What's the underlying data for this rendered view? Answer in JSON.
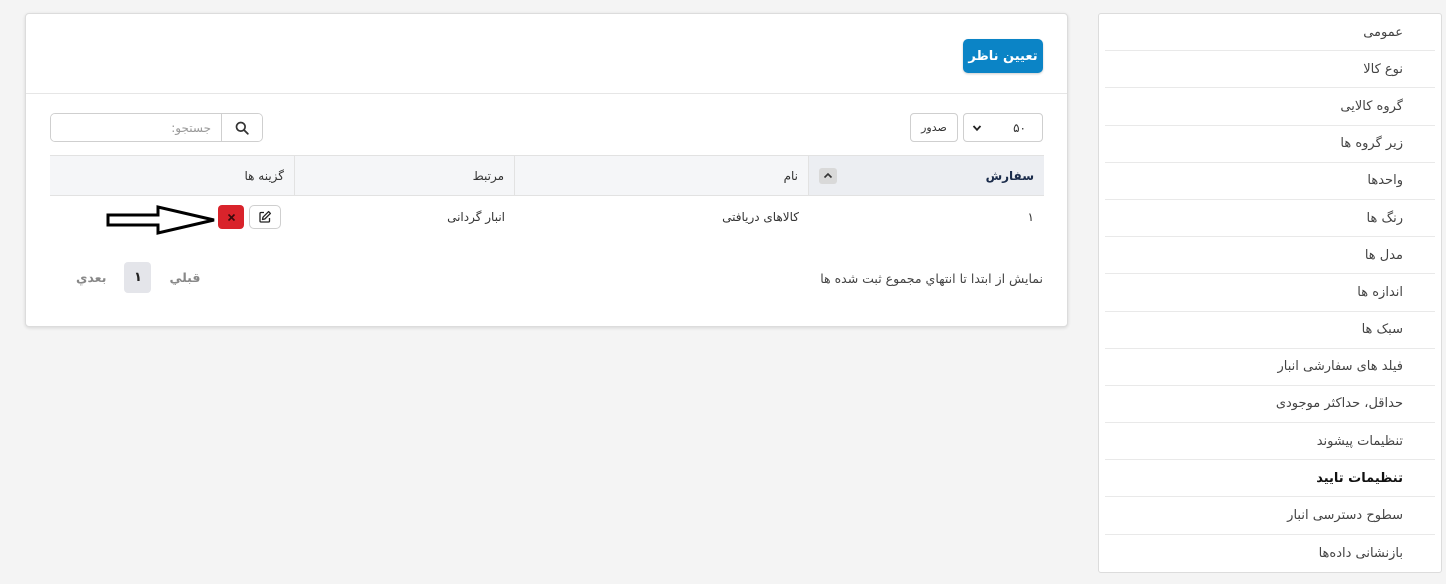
{
  "sidebar": {
    "items": [
      {
        "label": "عمومی"
      },
      {
        "label": "نوع کالا"
      },
      {
        "label": "گروه کالایی"
      },
      {
        "label": "زیر گروه ها"
      },
      {
        "label": "واحدها"
      },
      {
        "label": "رنگ ها"
      },
      {
        "label": "مدل ها"
      },
      {
        "label": "اندازه ها"
      },
      {
        "label": "سبک ها"
      },
      {
        "label": "فیلد های سفارشی انبار"
      },
      {
        "label": "حداقل، حداکثر موجودی"
      },
      {
        "label": "تنظیمات پیشوند"
      },
      {
        "label": "تنظیمات تایید"
      },
      {
        "label": "سطوح دسترسی انبار"
      },
      {
        "label": "بازنشانی داده‌ها"
      }
    ],
    "active_index": 12
  },
  "card": {
    "assign_button": "تعیین ناظر"
  },
  "controls": {
    "page_size": "۵۰",
    "export_label": "صدور",
    "search_placeholder": "جستجو:"
  },
  "table": {
    "headers": {
      "order": "سفارش",
      "name": "نام",
      "related": "مرتبط",
      "options": "گزینه ها"
    },
    "rows": [
      {
        "order": "۱",
        "name": "کالاهای دریافتی",
        "related": "انبار گردانی"
      }
    ]
  },
  "footer": {
    "info": "نمایش از ابتدا تا انتهاي مجموع ثبت شده ها",
    "prev": "قبلي",
    "next": "بعدي",
    "page": "۱"
  },
  "colors": {
    "primary": "#0b84c6",
    "danger": "#d9232b"
  },
  "icons": [
    "search-icon",
    "chevron-down-icon",
    "sort-up-icon",
    "edit-icon",
    "close-icon",
    "arrow-right-annotation"
  ]
}
